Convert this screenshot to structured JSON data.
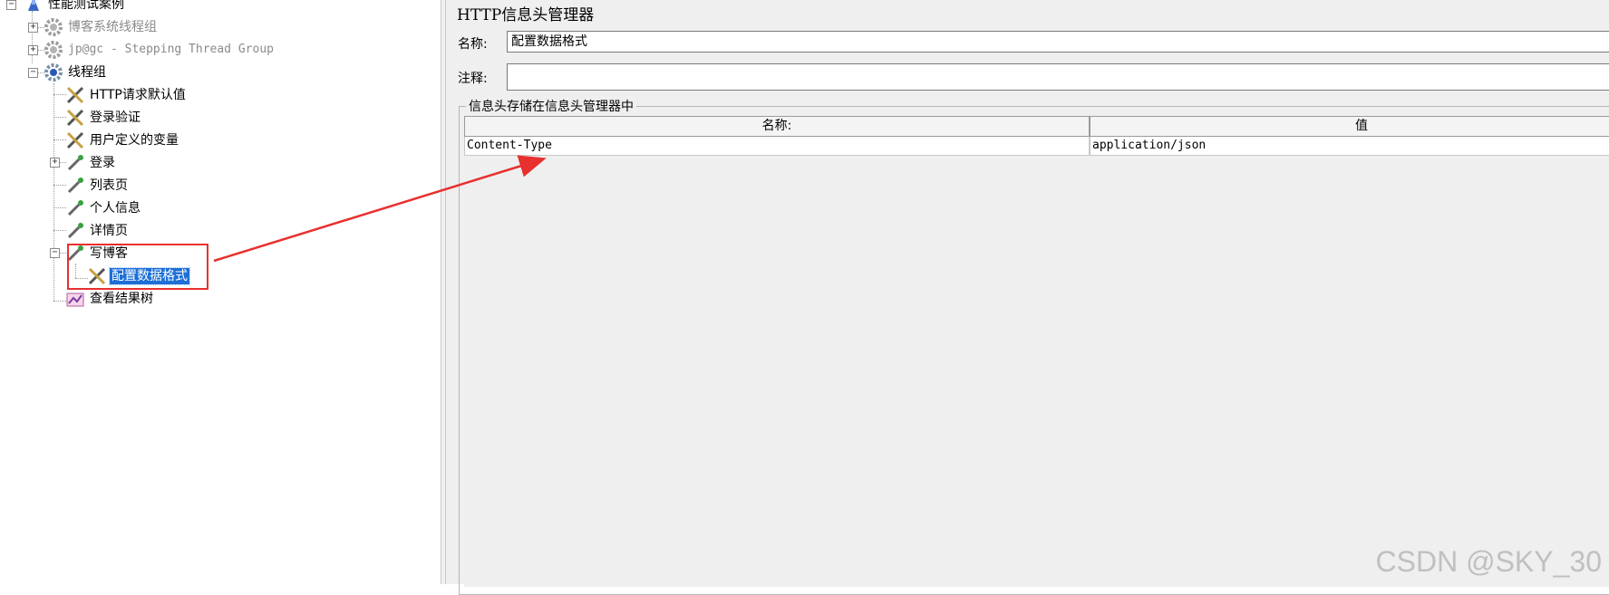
{
  "tree": {
    "items": [
      {
        "label": "性能测试案例",
        "icon": "test-plan-icon",
        "style": "normal"
      },
      {
        "label": "博客系统线程组",
        "icon": "gear-icon-disabled",
        "style": "disabled"
      },
      {
        "label": "jp@gc - Stepping Thread Group",
        "icon": "gear-icon-disabled",
        "style": "disabled-mono"
      },
      {
        "label": "线程组",
        "icon": "gear-icon",
        "style": "normal"
      },
      {
        "label": "HTTP请求默认值",
        "icon": "wrench-screwdriver-icon",
        "style": "normal"
      },
      {
        "label": "登录验证",
        "icon": "wrench-screwdriver-icon",
        "style": "normal"
      },
      {
        "label": "用户定义的变量",
        "icon": "wrench-screwdriver-icon",
        "style": "normal"
      },
      {
        "label": "登录",
        "icon": "pipette-icon",
        "style": "normal"
      },
      {
        "label": "列表页",
        "icon": "pipette-icon",
        "style": "normal"
      },
      {
        "label": "个人信息",
        "icon": "pipette-icon",
        "style": "normal"
      },
      {
        "label": "详情页",
        "icon": "pipette-icon",
        "style": "normal"
      },
      {
        "label": "写博客",
        "icon": "pipette-icon",
        "style": "normal"
      },
      {
        "label": "配置数据格式",
        "icon": "wrench-screwdriver-icon",
        "style": "selected"
      },
      {
        "label": "查看结果树",
        "icon": "listener-chart-icon",
        "style": "normal"
      }
    ]
  },
  "panel": {
    "title": "HTTP信息头管理器",
    "name_label": "名称:",
    "name_value": "配置数据格式",
    "comment_label": "注释:",
    "comment_value": "",
    "group_title": "信息头存储在信息头管理器中",
    "table": {
      "columns": [
        "名称:",
        "值"
      ],
      "rows": [
        [
          "Content-Type",
          "application/json"
        ]
      ]
    }
  },
  "watermark": "CSDN @SKY_30",
  "colors": {
    "selection": "#1d6fd6",
    "annotation_red": "#e8302f",
    "panel_bg": "#efefef"
  }
}
